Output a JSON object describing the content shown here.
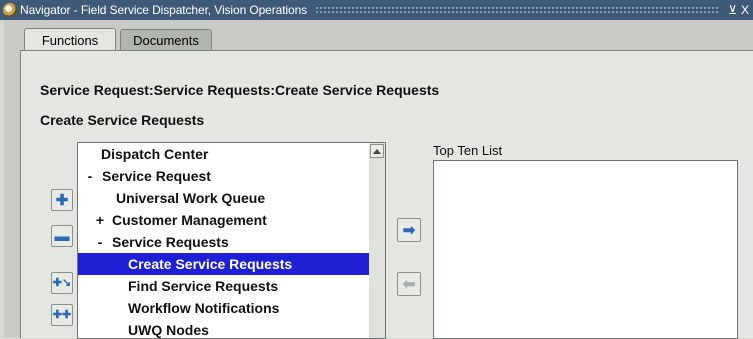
{
  "window": {
    "title": "Navigator - Field Service Dispatcher, Vision Operations",
    "minimize_glyph": "⊻",
    "close_glyph": "X"
  },
  "tabs": [
    {
      "label": "Functions",
      "active": true
    },
    {
      "label": "Documents",
      "active": false
    }
  ],
  "breadcrumb": "Service Request:Service Requests:Create Service Requests",
  "section_title": "Create Service Requests",
  "tree": {
    "nodes": [
      {
        "sign": "",
        "label": "Dispatch Center",
        "level": 1
      },
      {
        "sign": "-",
        "label": "Service Request",
        "level": 0
      },
      {
        "sign": "",
        "label": "Universal Work Queue",
        "level": 1
      },
      {
        "sign": "+",
        "label": "Customer Management",
        "level": 0
      },
      {
        "sign": "-",
        "label": "Service Requests",
        "level": 0
      },
      {
        "sign": "",
        "label": "Create Service Requests",
        "level": 2,
        "selected": true
      },
      {
        "sign": "",
        "label": "Find Service Requests",
        "level": 2
      },
      {
        "sign": "",
        "label": "Workflow Notifications",
        "level": 2
      },
      {
        "sign": "",
        "label": "UWQ Nodes",
        "level": 2
      }
    ]
  },
  "side_buttons": {
    "expand_icon": "expand-plus-icon",
    "collapse_icon": "collapse-minus-icon",
    "expand_branch_icon": "expand-branch-icon",
    "expand_all_icon": "expand-all-icon"
  },
  "transfer_buttons": {
    "add_icon": "right-arrow-icon",
    "remove_icon": "left-arrow-icon"
  },
  "top_ten": {
    "label": "Top Ten List",
    "items": []
  },
  "colors": {
    "selection": "#1f1fd6",
    "titlebar": "#3f5a78",
    "panel": "#e4e7e1"
  }
}
